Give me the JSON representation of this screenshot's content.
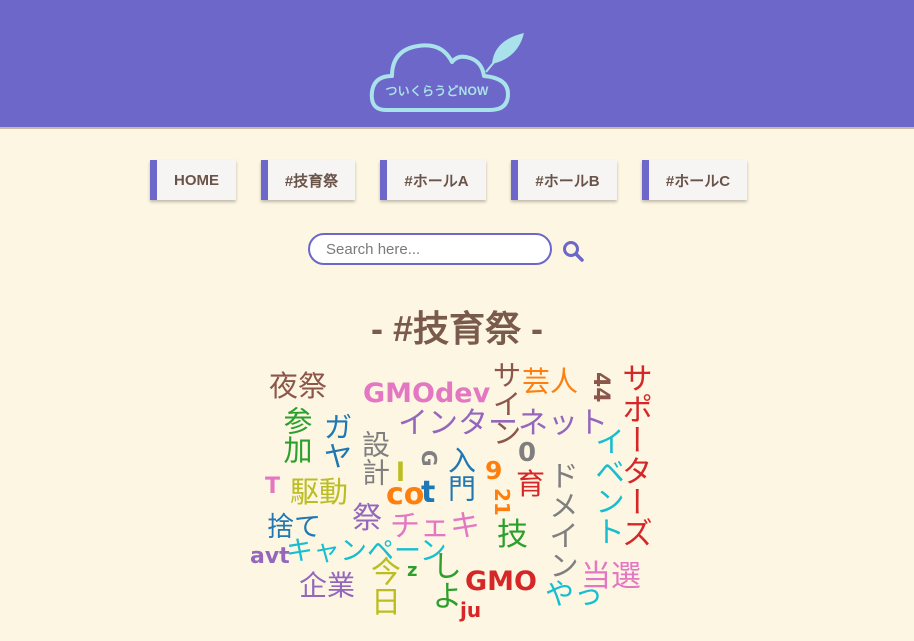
{
  "header": {
    "logo_text": "ついくらうどNOW",
    "colors": {
      "bar": "#6c67c8",
      "cloud_outline": "#a9e2ea",
      "leaf": "#a9e2ea"
    }
  },
  "nav": {
    "items": [
      {
        "label": "HOME"
      },
      {
        "label": "#技育祭"
      },
      {
        "label": "#ホールA"
      },
      {
        "label": "#ホールB"
      },
      {
        "label": "#ホールC"
      }
    ]
  },
  "search": {
    "placeholder": "Search here...",
    "value": "",
    "icon": "search-icon"
  },
  "page": {
    "title": "- #技育祭 -"
  },
  "word_cloud": {
    "words": [
      {
        "text": "夜祭",
        "color": "#8c564b"
      },
      {
        "text": "GMOdev",
        "color": "#e377c2"
      },
      {
        "text": "サイン",
        "color": "#8c564b"
      },
      {
        "text": "芸人",
        "color": "#ff7f0e"
      },
      {
        "text": "44",
        "color": "#8c564b"
      },
      {
        "text": "サポーターズ",
        "color": "#d62728"
      },
      {
        "text": "参加",
        "color": "#2ca02c"
      },
      {
        "text": "ガヤ",
        "color": "#1f77b4"
      },
      {
        "text": "設計",
        "color": "#7f7f7f"
      },
      {
        "text": "インターネット",
        "color": "#9467bd"
      },
      {
        "text": "イベント",
        "color": "#17becf"
      },
      {
        "text": "G",
        "color": "#7f7f7f"
      },
      {
        "text": "入門",
        "color": "#1f77b4"
      },
      {
        "text": "9",
        "color": "#ff7f0e"
      },
      {
        "text": "0",
        "color": "#7f7f7f"
      },
      {
        "text": "育",
        "color": "#d62728"
      },
      {
        "text": "ドメイン",
        "color": "#7f7f7f"
      },
      {
        "text": "T",
        "color": "#e377c2"
      },
      {
        "text": "駆動",
        "color": "#bcbd22"
      },
      {
        "text": "l",
        "color": "#bcbd22"
      },
      {
        "text": "co",
        "color": "#ff7f0e"
      },
      {
        "text": "t",
        "color": "#1f77b4"
      },
      {
        "text": "21",
        "color": "#ff7f0e"
      },
      {
        "text": "捨て",
        "color": "#1f77b4"
      },
      {
        "text": "祭",
        "color": "#9467bd"
      },
      {
        "text": "チェキ",
        "color": "#e377c2"
      },
      {
        "text": "技",
        "color": "#2ca02c"
      },
      {
        "text": "キャンペーン",
        "color": "#17becf"
      },
      {
        "text": "avt",
        "color": "#9467bd"
      },
      {
        "text": "企業",
        "color": "#9467bd"
      },
      {
        "text": "今日",
        "color": "#bcbd22"
      },
      {
        "text": "z",
        "color": "#2ca02c"
      },
      {
        "text": "しよ",
        "color": "#2ca02c"
      },
      {
        "text": "GMO",
        "color": "#d62728"
      },
      {
        "text": "ju",
        "color": "#d62728"
      },
      {
        "text": "やっ",
        "color": "#17becf"
      },
      {
        "text": "当選",
        "color": "#e377c2"
      }
    ]
  }
}
